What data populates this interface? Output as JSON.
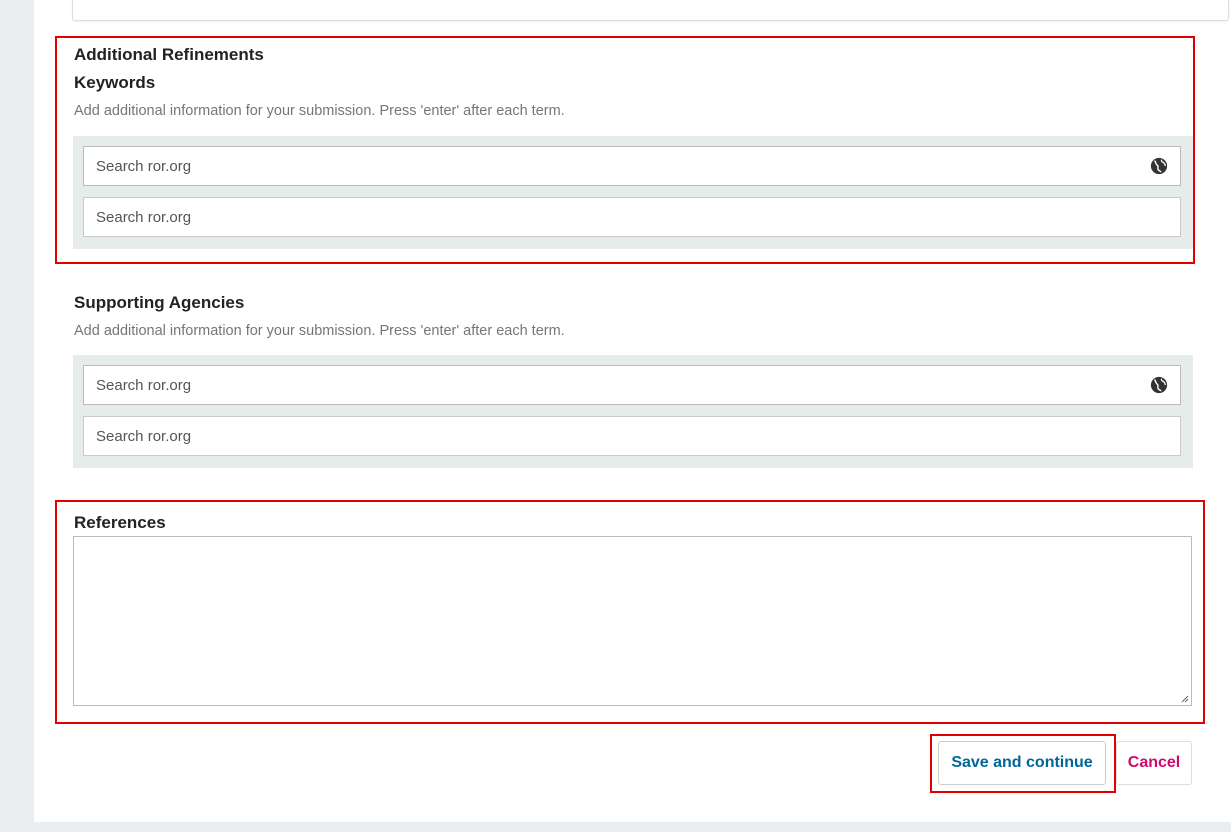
{
  "refinements": {
    "section_title": "Additional Refinements",
    "keywords_label": "Keywords",
    "keywords_description": "Add additional information for your submission. Press 'enter' after each term.",
    "keywords_input_placeholder": "Search ror.org",
    "keywords_second_placeholder": "Search ror.org"
  },
  "agencies": {
    "label": "Supporting Agencies",
    "description": "Add additional information for your submission. Press 'enter' after each term.",
    "input_placeholder": "Search ror.org",
    "second_placeholder": "Search ror.org"
  },
  "references": {
    "label": "References",
    "value": ""
  },
  "actions": {
    "save_label": "Save and continue",
    "cancel_label": "Cancel"
  },
  "colors": {
    "highlight": "#e00000",
    "primary": "#006798",
    "cancel": "#d00a6c"
  },
  "icons": {
    "globe": "globe-icon",
    "resize": "resize-handle-icon"
  }
}
